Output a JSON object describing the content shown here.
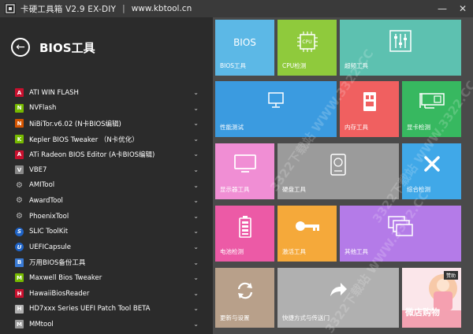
{
  "window": {
    "title": "卡硬工具箱 V2.9  EX-DIY",
    "separator": "|",
    "url": "www.kbtool.cn",
    "minimize_glyph": "—",
    "close_glyph": "✕"
  },
  "left_panel": {
    "back_glyph": "←",
    "section_title": "BIOS工具",
    "chevron": "⌄",
    "tools": [
      {
        "label": "ATI WIN FLASH",
        "icon": "ati-icon",
        "mark": "A"
      },
      {
        "label": "NVFlash",
        "icon": "nvidia-icon",
        "mark": "N"
      },
      {
        "label": "NiBiTor.v6.02 (N卡BIOS编辑)",
        "icon": "nibitor-icon",
        "mark": "N"
      },
      {
        "label": "Kepler BIOS Tweaker （N卡优化）",
        "icon": "nvidia-icon",
        "mark": "K"
      },
      {
        "label": "ATi Radeon BIOS Editor (A卡BIOS编辑)",
        "icon": "ati-icon",
        "mark": "A"
      },
      {
        "label": "VBE7",
        "icon": "app-icon",
        "mark": "V"
      },
      {
        "label": "AMITool",
        "icon": "gear-icon",
        "mark": "⚙"
      },
      {
        "label": "AwardTool",
        "icon": "gear-icon",
        "mark": "⚙"
      },
      {
        "label": "PhoenixTool",
        "icon": "gear-icon",
        "mark": "⚙"
      },
      {
        "label": "SLIC ToolKit",
        "icon": "slic-icon",
        "mark": "S"
      },
      {
        "label": "UEFICapsule",
        "icon": "uefi-icon",
        "mark": "U"
      },
      {
        "label": "万用BIOS备份工具",
        "icon": "backup-icon",
        "mark": "B"
      },
      {
        "label": "Maxwell Bios Tweaker",
        "icon": "nvidia-icon",
        "mark": "M"
      },
      {
        "label": "HawaiiBiosReader",
        "icon": "ati-icon",
        "mark": "H"
      },
      {
        "label": "HD7xxx Series UEFI Patch Tool BETA",
        "icon": "patch-icon",
        "mark": "H"
      },
      {
        "label": "MMtool",
        "icon": "mmtool-icon",
        "mark": "M"
      }
    ]
  },
  "tiles": {
    "bios": {
      "label": "BIOS工具",
      "text": "BIOS",
      "color": "#5cb8e6"
    },
    "cpu": {
      "label": "CPU检测",
      "text": "CPU",
      "color": "#8fca3c"
    },
    "overclock": {
      "label": "超频工具",
      "color": "#5dc1b0"
    },
    "perf": {
      "label": "性能测试",
      "color": "#3b9be0"
    },
    "memory": {
      "label": "内存工具",
      "color": "#f06060"
    },
    "gpu": {
      "label": "显卡检测",
      "color": "#37b860"
    },
    "display": {
      "label": "显示器工具",
      "color": "#f08ed4"
    },
    "disk": {
      "label": "硬盘工具",
      "color": "#9b9b9b"
    },
    "integrated": {
      "label": "综合检测",
      "color": "#40a8e8"
    },
    "battery": {
      "label": "电池检测",
      "color": "#ec5aa6"
    },
    "activate": {
      "label": "激活工具",
      "color": "#f5a93a"
    },
    "other": {
      "label": "其他工具",
      "color": "#b47be8"
    },
    "update": {
      "label": "更新与设置",
      "color": "#b8a08a"
    },
    "shortcut": {
      "label": "快捷方式与传送门",
      "color": "#b0b0b0"
    },
    "ad": {
      "badge": "赞助",
      "text": "微店购物",
      "color": "#f3a1b1"
    }
  },
  "watermark": {
    "text": "3322下载站 WWW.3322.CC"
  }
}
